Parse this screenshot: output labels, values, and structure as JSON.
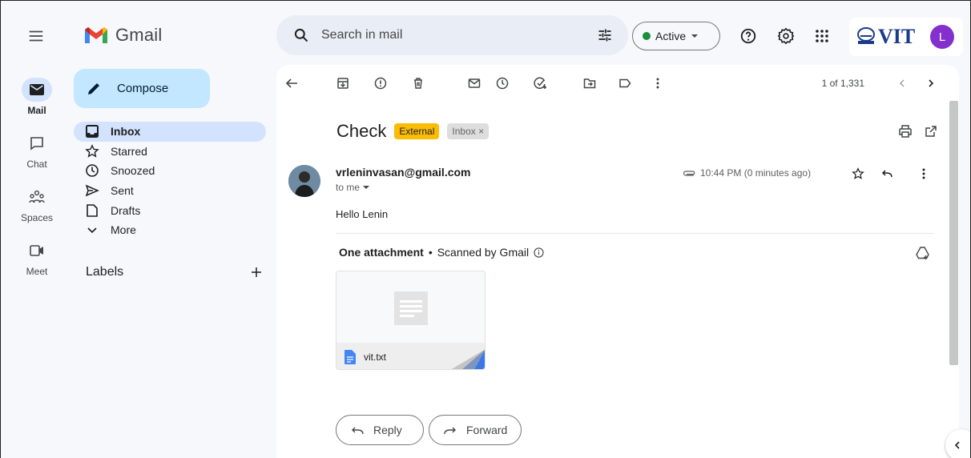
{
  "app": {
    "name": "Gmail"
  },
  "search": {
    "placeholder": "Search in mail"
  },
  "status": {
    "label": "Active",
    "color": "#1e8e3e"
  },
  "org_logo": {
    "text": "VIT"
  },
  "account": {
    "initial": "L",
    "color": "#8430ce"
  },
  "rail": [
    {
      "label": "Mail",
      "icon": "mail-icon",
      "active": true
    },
    {
      "label": "Chat",
      "icon": "chat-icon"
    },
    {
      "label": "Spaces",
      "icon": "spaces-icon"
    },
    {
      "label": "Meet",
      "icon": "meet-icon"
    }
  ],
  "compose": {
    "label": "Compose"
  },
  "nav": [
    {
      "label": "Inbox",
      "icon": "inbox-icon",
      "active": true
    },
    {
      "label": "Starred",
      "icon": "star-icon"
    },
    {
      "label": "Snoozed",
      "icon": "clock-icon"
    },
    {
      "label": "Sent",
      "icon": "send-icon"
    },
    {
      "label": "Drafts",
      "icon": "draft-icon"
    },
    {
      "label": "More",
      "icon": "chevron-down-icon"
    }
  ],
  "labels": {
    "title": "Labels"
  },
  "pager": {
    "text": "1 of 1,331"
  },
  "email": {
    "subject": "Check",
    "badges": {
      "external": "External",
      "inbox": "Inbox"
    },
    "sender": "vrleninvasan@gmail.com",
    "to": "to me",
    "time": "10:44 PM (0 minutes ago)",
    "body": "Hello Lenin",
    "attachment_title": "One attachment",
    "scanned": "Scanned by Gmail",
    "attachment_name": "vit.txt"
  },
  "actions": {
    "reply": "Reply",
    "forward": "Forward"
  },
  "colors": {
    "accent": "#0b57d0",
    "compose_bg": "#c2e7ff",
    "selected_bg": "#d3e3fd",
    "external_badge": "#fbbc04"
  }
}
